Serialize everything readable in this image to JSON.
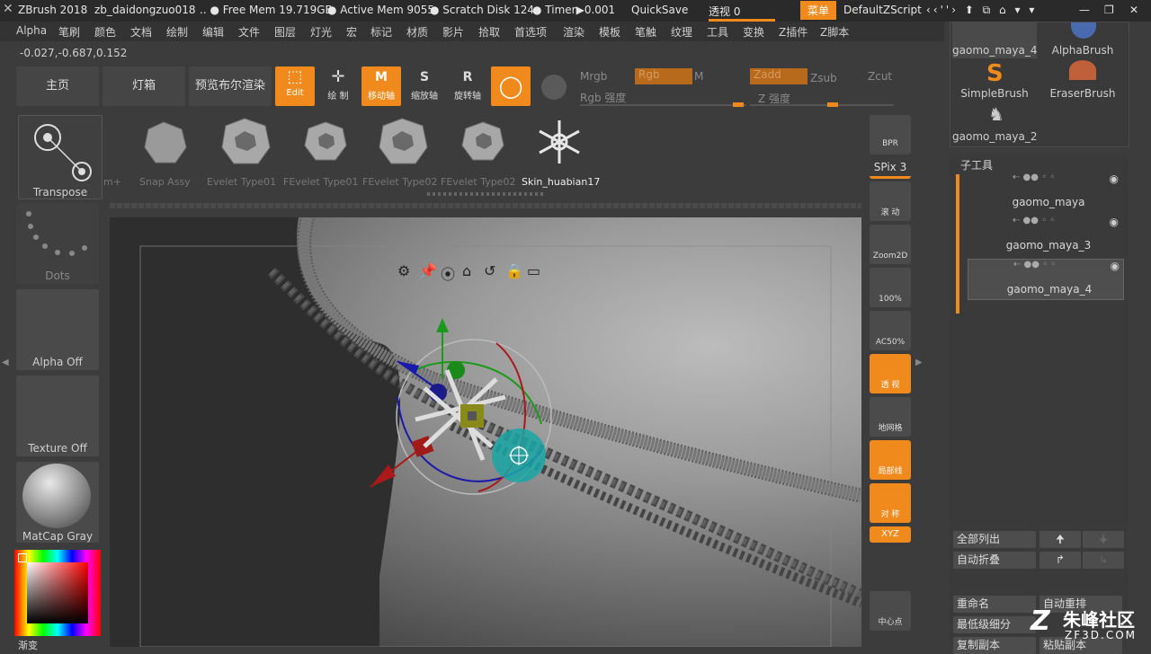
{
  "titlebar": {
    "app": "ZBrush 2018",
    "document": "zb_daidongzuo018",
    "free_mem": "Free Mem 19.719GB",
    "active_mem": "Active Mem 9055",
    "scratch": "Scratch Disk 124",
    "timer": "Timer▶0.001",
    "quicksave": "QuickSave",
    "see_through": "透视 0",
    "menu_btn": "菜单",
    "script": "DefaultZScript"
  },
  "menu": [
    "Alpha",
    "笔刷",
    "颜色",
    "文档",
    "绘制",
    "编辑",
    "文件",
    "图层",
    "灯光",
    "宏",
    "标记",
    "材质",
    "影片",
    "拾取",
    "首选项",
    "渲染",
    "模板",
    "笔触",
    "纹理",
    "工具",
    "变换",
    "Z插件",
    "Z脚本"
  ],
  "coords": "-0.027,-0.687,0.152",
  "toolbar": {
    "home": "主页",
    "lightbox": "灯箱",
    "bpr_preview": "预览布尔渲染",
    "edit": "Edit",
    "draw": "绘 制",
    "move": "移动轴",
    "scale": "缩放轴",
    "rotate": "旋转轴",
    "mrgb": "Mrgb",
    "rgb": "Rgb",
    "m": "M",
    "rgb_intensity": "Rgb 强度",
    "zadd": "Zadd",
    "zsub": "Zsub",
    "zcut": "Zcut",
    "z_intensity": "Z 强度"
  },
  "left": {
    "transpose": "Transpose",
    "dots": "Dots",
    "alpha": "Alpha Off",
    "texture": "Texture Off",
    "matcap": "MatCap Gray",
    "gradient": "渐变"
  },
  "shelf": [
    "m+",
    "Snap Assy",
    "Evelet Type01",
    "FEvelet Type01",
    "FEvelet Type02",
    "FEvelet Type02",
    "Skin_huabian17"
  ],
  "gizmo_icons": [
    "gear-icon",
    "pin-icon",
    "location-icon",
    "home-icon",
    "undo-icon",
    "lock-icon",
    "minus-icon"
  ],
  "right_shelf": [
    {
      "label": "BPR",
      "type": "bpr"
    },
    {
      "label": "SPix 3",
      "type": "spix"
    },
    {
      "label": "滚 动",
      "type": "btn"
    },
    {
      "label": "Zoom2D",
      "type": "btn"
    },
    {
      "label": "100%",
      "type": "btn"
    },
    {
      "label": "AC50%",
      "type": "btn"
    },
    {
      "label": "透 视",
      "sub": "Dynamic",
      "type": "or"
    },
    {
      "label": "地网格",
      "type": "btn"
    },
    {
      "label": "局部线",
      "type": "or"
    },
    {
      "label": "对 称",
      "type": "or"
    },
    {
      "label": "XYZ",
      "type": "or-small"
    },
    {
      "label": "中心点",
      "type": "btn"
    }
  ],
  "brushes": [
    {
      "label": "gaomo_maya_4"
    },
    {
      "label": "AlphaBrush"
    },
    {
      "label": "SimpleBrush"
    },
    {
      "label": "EraserBrush"
    },
    {
      "label": "gaomo_maya_2"
    }
  ],
  "subtool": {
    "title": "子工具",
    "items": [
      "gaomo_maya",
      "gaomo_maya_3",
      "gaomo_maya_4"
    ]
  },
  "subtool_buttons": {
    "list_all": "全部列出",
    "auto_collapse": "自动折叠",
    "rename": "重命名",
    "auto_reorder": "自动重排",
    "lowest_subdiv": "最低级细分",
    "duplicate": "复制副本",
    "paste_dup": "粘贴副本"
  },
  "watermark": {
    "brand": "朱峰社区",
    "url": "ZF3D.COM"
  },
  "colors": {
    "accent": "#f08a1c",
    "bg": "#3c3c3c",
    "panel": "#4a4a4a",
    "cyan": "#1aa6a6"
  }
}
